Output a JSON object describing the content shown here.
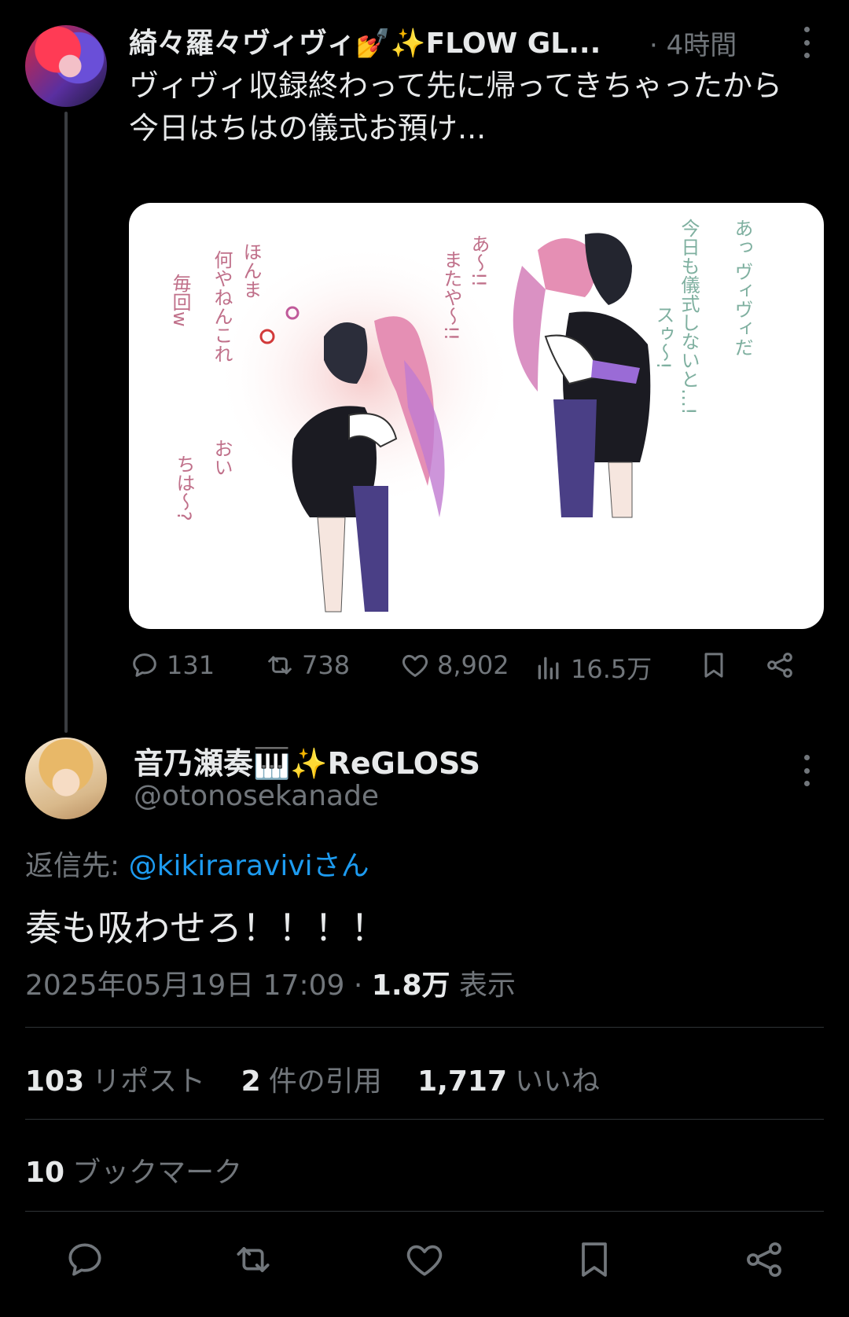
{
  "parent_tweet": {
    "display_name": "綺々羅々ヴィヴィ💅✨FLOW GL...",
    "time": "· 4時間",
    "text_line1": "ヴィヴィ収録終わって先に帰ってきちゃったから",
    "text_line2": "今日はちはの儀式お預け...",
    "image_text": {
      "left_1": "ほんま",
      "left_2": "何やねんこれ",
      "left_3": "毎回w",
      "left_4": "おい",
      "left_5": "ちは〜?",
      "mid_1": "あ〜!!",
      "mid_2": "またや〜!!",
      "right_1": "あっ ヴィヴィだ",
      "right_2": "今日も儀式しないと…!",
      "right_3": "スゥ〜!"
    },
    "stats": {
      "replies": "131",
      "reposts": "738",
      "likes": "8,902",
      "views": "16.5万"
    }
  },
  "reply_tweet": {
    "display_name": "音乃瀬奏🎹✨ReGLOSS",
    "handle": "@otonosekanade",
    "reply_to_label": "返信先:",
    "reply_to_mention": "@kikiraraviviさん",
    "text": "奏も吸わせろ！！！！",
    "timestamp": "2025年05月19日 17:09",
    "views_count": "1.8万",
    "views_label": "表示",
    "repost_count": "103",
    "repost_label": "リポスト",
    "quote_count": "2",
    "quote_label": "件の引用",
    "like_count": "1,717",
    "like_label": "いいね",
    "bookmark_count": "10",
    "bookmark_label": "ブックマーク"
  },
  "colors": {
    "background": "#000000",
    "text": "#e7e9ea",
    "muted": "#71767b",
    "link": "#1d9bf0",
    "divider": "#2f3336"
  },
  "icons": [
    "more-icon",
    "reply-icon",
    "repost-icon",
    "like-icon",
    "views-icon",
    "bookmark-icon",
    "share-icon"
  ]
}
